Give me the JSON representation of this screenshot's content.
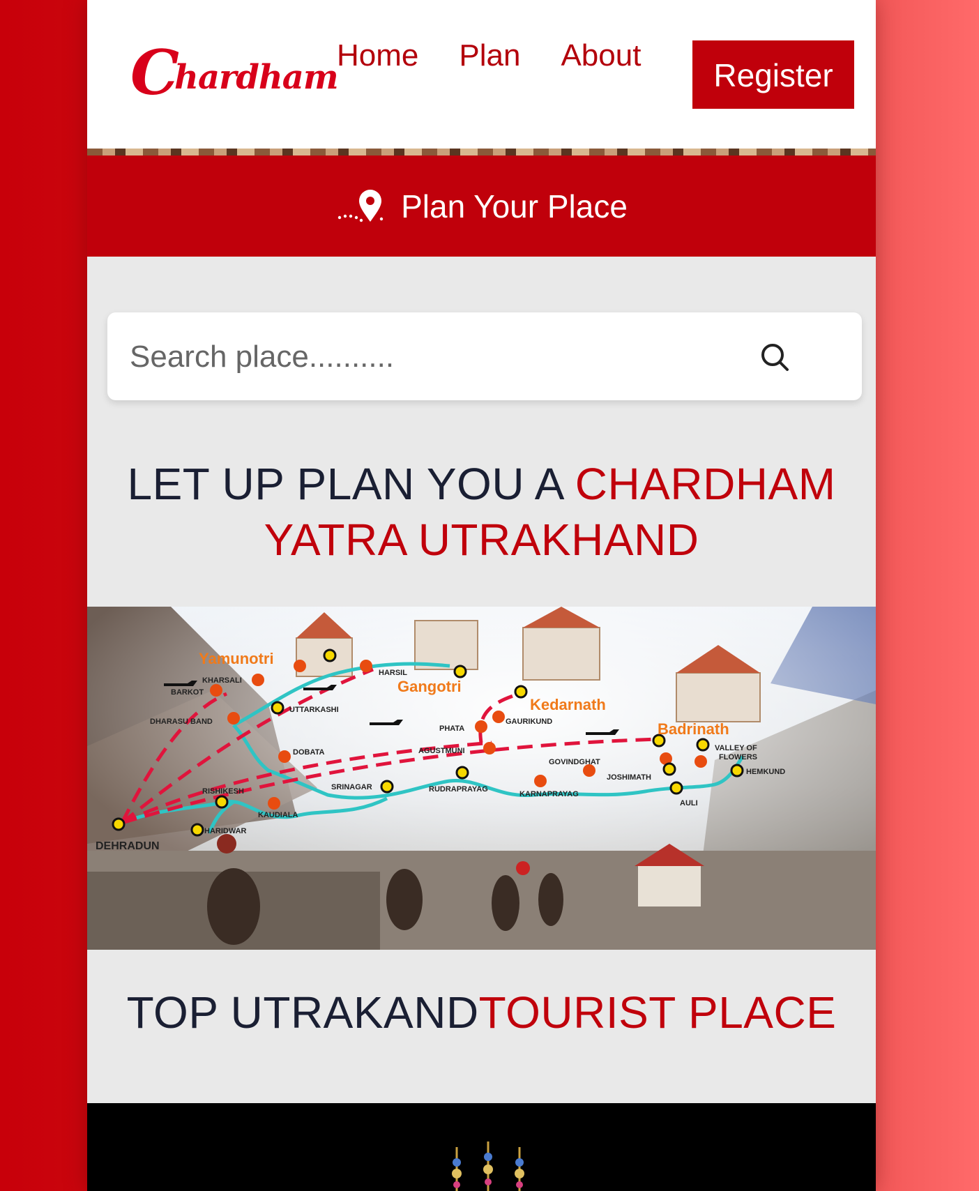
{
  "header": {
    "logo_text": "Chardham",
    "nav": {
      "home": "Home",
      "plan": "Plan",
      "about": "About"
    },
    "register_label": "Register"
  },
  "banner": {
    "icon": "map-pin-route-icon",
    "title": "Plan Your Place"
  },
  "search": {
    "placeholder": "Search place.........."
  },
  "headline1": {
    "dark": "LET UP PLAN YOU A ",
    "red": "CHARDHAM YATRA UTRAKHAND"
  },
  "map": {
    "shrines": [
      "Yamunotri",
      "Gangotri",
      "Kedarnath",
      "Badrinath"
    ],
    "places": [
      "KHARSALI",
      "BARKOT",
      "HARSIL",
      "UTTARKASHI",
      "DHARASU BAND",
      "DOBATA",
      "PHATA",
      "GAURIKUND",
      "AGUSTMUNI",
      "GOVINDGHAT",
      "VALLEY OF FLOWERS",
      "HEMKUND",
      "JOSHIMATH",
      "AULI",
      "SRINAGAR",
      "RUDRAPRAYAG",
      "KARNAPRAYAG",
      "RISHIKESH",
      "KAUDIALA",
      "HARIDWAR",
      "DEHRADUN"
    ],
    "colors": {
      "road": "#2fc4c4",
      "heli": "#e0143c",
      "label": "#f07a1a"
    }
  },
  "headline2": {
    "dark": "TOP UTRAKAND",
    "red": "TOURIST PLACE"
  }
}
